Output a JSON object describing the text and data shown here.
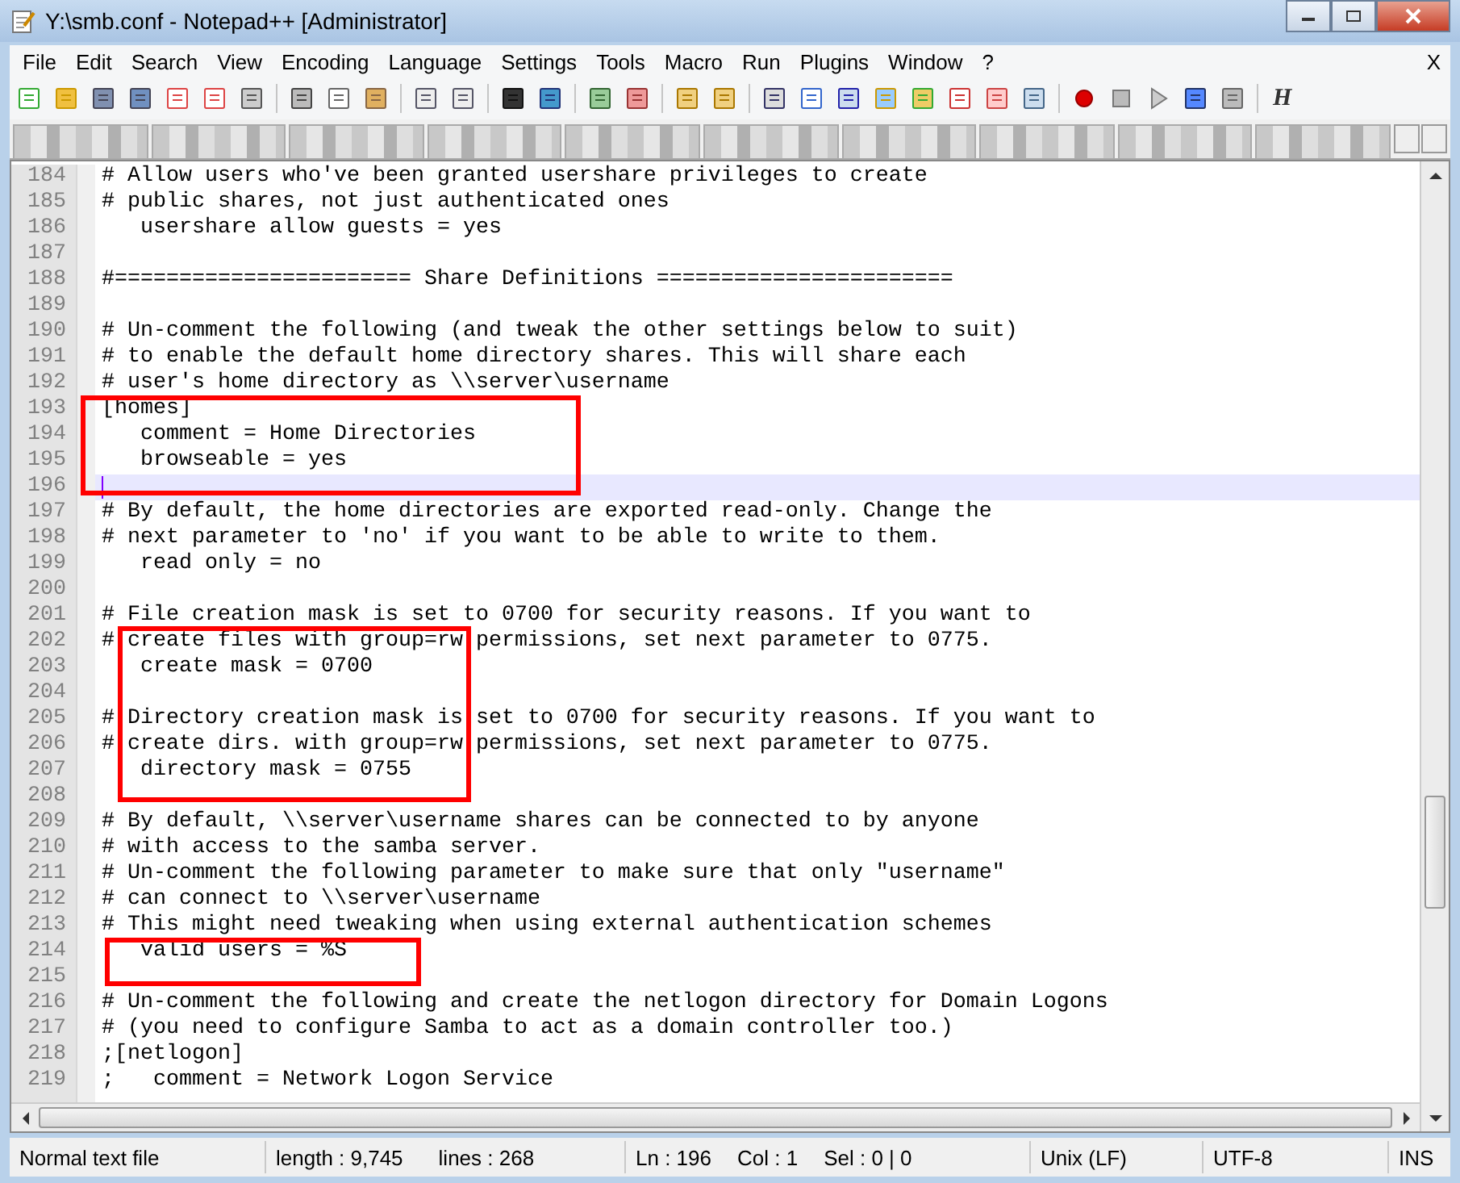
{
  "window": {
    "title": "Y:\\smb.conf - Notepad++ [Administrator]"
  },
  "menu": [
    "File",
    "Edit",
    "Search",
    "View",
    "Encoding",
    "Language",
    "Settings",
    "Tools",
    "Macro",
    "Run",
    "Plugins",
    "Window",
    "?"
  ],
  "menu_close": "X",
  "toolbar_letter": "H",
  "editor": {
    "lines": [
      {
        "number": "184",
        "text": "# Allow users who've been granted usershare privileges to create",
        "current": false
      },
      {
        "number": "185",
        "text": "# public shares, not just authenticated ones",
        "current": false
      },
      {
        "number": "186",
        "text": "   usershare allow guests = yes",
        "current": false
      },
      {
        "number": "187",
        "current": false
      },
      {
        "number": "188",
        "text": "#======================= Share Definitions =======================",
        "current": false
      },
      {
        "number": "189",
        "current": false
      },
      {
        "number": "190",
        "text": "# Un-comment the following (and tweak the other settings below to suit)",
        "current": false
      },
      {
        "number": "191",
        "text": "# to enable the default home directory shares. This will share each",
        "current": false
      },
      {
        "number": "192",
        "text": "# user's home directory as \\\\server\\username",
        "current": false
      },
      {
        "number": "193",
        "text": "[homes]",
        "current": false
      },
      {
        "number": "194",
        "text": "   comment = Home Directories",
        "current": false
      },
      {
        "number": "195",
        "text": "   browseable = yes",
        "current": false
      },
      {
        "number": "196",
        "current": true
      },
      {
        "number": "197",
        "text": "# By default, the home directories are exported read-only. Change the",
        "current": false
      },
      {
        "number": "198",
        "text": "# next parameter to 'no' if you want to be able to write to them.",
        "current": false
      },
      {
        "number": "199",
        "text": "   read only = no",
        "current": false
      },
      {
        "number": "200",
        "current": false
      },
      {
        "number": "201",
        "text": "# File creation mask is set to 0700 for security reasons. If you want to",
        "current": false
      },
      {
        "number": "202",
        "text": "# create files with group=rw permissions, set next parameter to 0775.",
        "current": false
      },
      {
        "number": "203",
        "text": "   create mask = 0700",
        "current": false
      },
      {
        "number": "204",
        "current": false
      },
      {
        "number": "205",
        "text": "# Directory creation mask is set to 0700 for security reasons. If you want to",
        "current": false
      },
      {
        "number": "206",
        "text": "# create dirs. with group=rw permissions, set next parameter to 0775.",
        "current": false
      },
      {
        "number": "207",
        "text": "   directory mask = 0755",
        "current": false
      },
      {
        "number": "208",
        "current": false
      },
      {
        "number": "209",
        "text": "# By default, \\\\server\\username shares can be connected to by anyone",
        "current": false
      },
      {
        "number": "210",
        "text": "# with access to the samba server.",
        "current": false
      },
      {
        "number": "211",
        "text": "# Un-comment the following parameter to make sure that only \"username\"",
        "current": false
      },
      {
        "number": "212",
        "text": "# can connect to \\\\server\\username",
        "current": false
      },
      {
        "number": "213",
        "text": "# This might need tweaking when using external authentication schemes",
        "current": false
      },
      {
        "number": "214",
        "text": "   valid users = %S",
        "current": false
      },
      {
        "number": "215",
        "current": false
      },
      {
        "number": "216",
        "text": "# Un-comment the following and create the netlogon directory for Domain Logons",
        "current": false
      },
      {
        "number": "217",
        "text": "# (you need to configure Samba to act as a domain controller too.)",
        "current": false
      },
      {
        "number": "218",
        "text": ";[netlogon]",
        "current": false
      },
      {
        "number": "219",
        "text": ";   comment = Network Logon Service",
        "current": false
      }
    ]
  },
  "status_bar": {
    "file_type": "Normal text file",
    "length": "length : 9,745",
    "lines": "lines : 268",
    "ln": "Ln : 196",
    "col": "Col : 1",
    "sel": "Sel : 0 | 0",
    "eol": "Unix (LF)",
    "encoding": "UTF-8",
    "mode": "INS"
  }
}
